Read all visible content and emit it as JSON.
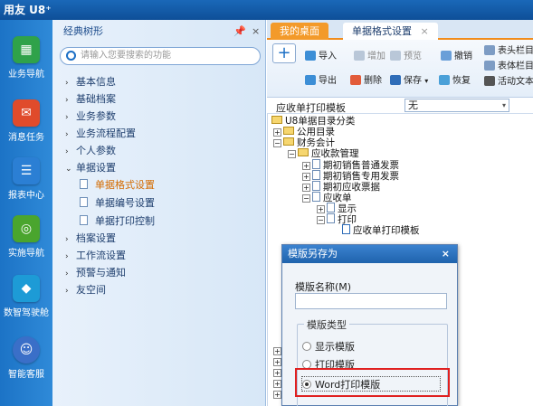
{
  "app": {
    "title": "用友 U8⁺"
  },
  "leftnav": [
    {
      "label": "业务导航",
      "icon": "grid-icon",
      "color": "#2fa24a"
    },
    {
      "label": "消息任务",
      "icon": "mail-icon",
      "color": "#e04b2b"
    },
    {
      "label": "报表中心",
      "icon": "report-icon",
      "color": "#2b7fd4"
    },
    {
      "label": "实施导航",
      "icon": "compass-icon",
      "color": "#4aa52e"
    },
    {
      "label": "数智驾驶舱",
      "icon": "cube-icon",
      "color": "#1d9bd6"
    },
    {
      "label": "智能客服",
      "icon": "robot-icon",
      "color": "#3a6fc8"
    }
  ],
  "tree_panel": {
    "title": "经典树形",
    "pin": "📌",
    "close": "×",
    "search_placeholder": "请输入您要搜索的功能",
    "menus": [
      "基本信息",
      "基础档案",
      "业务参数",
      "业务流程配置",
      "个人参数",
      "单据设置",
      "档案设置",
      "工作流设置",
      "预警与通知",
      "友空间"
    ],
    "subitems": [
      "单据格式设置",
      "单据编号设置",
      "单据打印控制"
    ]
  },
  "tabs": {
    "home": "我的桌面",
    "active": "单据格式设置",
    "close": "×"
  },
  "toolbar": {
    "plus": "+",
    "import": "导入",
    "add": "增加",
    "preview": "预览",
    "undo": "撤销",
    "export": "导出",
    "delete": "删除",
    "save": "保存",
    "restore": "恢复",
    "header_col": "表头栏目",
    "body_col": "表体栏目",
    "active_text": "活动文本"
  },
  "template_row": {
    "label": "应收单打印模板",
    "value": "无"
  },
  "tree": {
    "root": "U8单据目录分类",
    "public": "公用目录",
    "finance": "财务会计",
    "ar": "应收款管理",
    "n1": "期初销售普通发票",
    "n2": "期初销售专用发票",
    "n3": "期初应收票据",
    "n4": "应收单",
    "display": "显示",
    "print": "打印",
    "print_tpl": "应收单打印模板"
  },
  "dialog": {
    "title": "模版另存为",
    "close": "×",
    "name_label": "模版名称(M)",
    "name_value": "",
    "group_label": "模版类型",
    "options": [
      "显示模版",
      "打印模版",
      "Word打印模版"
    ],
    "selected": 2
  }
}
